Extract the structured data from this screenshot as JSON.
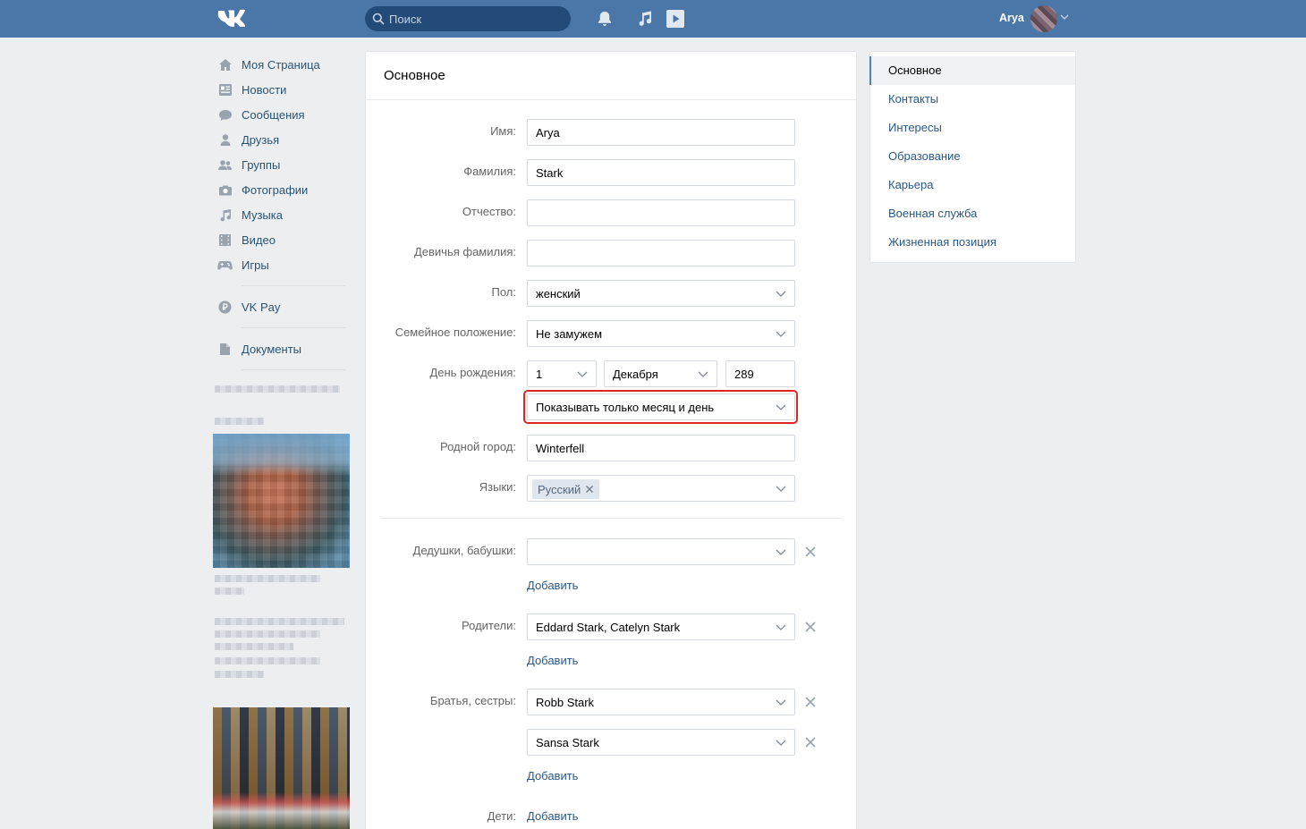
{
  "header": {
    "logo_text": "VK",
    "search_placeholder": "Поиск",
    "user_name": "Arya",
    "colors": {
      "bar": "#4a76a8",
      "search_bg": "#224b7a"
    }
  },
  "leftnav": {
    "items": [
      {
        "label": "Моя Страница",
        "icon": "home-icon"
      },
      {
        "label": "Новости",
        "icon": "news-icon"
      },
      {
        "label": "Сообщения",
        "icon": "messages-icon"
      },
      {
        "label": "Друзья",
        "icon": "friends-icon"
      },
      {
        "label": "Группы",
        "icon": "groups-icon"
      },
      {
        "label": "Фотографии",
        "icon": "camera-icon"
      },
      {
        "label": "Музыка",
        "icon": "music-icon"
      },
      {
        "label": "Видео",
        "icon": "video-icon"
      },
      {
        "label": "Игры",
        "icon": "gamepad-icon"
      }
    ],
    "pay": {
      "label": "VK Pay",
      "icon": "ruble-icon"
    },
    "docs": {
      "label": "Документы",
      "icon": "document-icon"
    }
  },
  "main": {
    "title": "Основное",
    "fields": {
      "first_name": {
        "label": "Имя:",
        "value": "Arya"
      },
      "last_name": {
        "label": "Фамилия:",
        "value": "Stark"
      },
      "patronymic": {
        "label": "Отчество:",
        "value": ""
      },
      "maiden_name": {
        "label": "Девичья фамилия:",
        "value": ""
      },
      "sex": {
        "label": "Пол:",
        "value": "женский"
      },
      "relationship": {
        "label": "Семейное положение:",
        "value": "Не замужем"
      },
      "birthday": {
        "label": "День рождения:",
        "day": "1",
        "month": "Декабря",
        "year": "289",
        "visibility": "Показывать только месяц и день"
      },
      "hometown": {
        "label": "Родной город:",
        "value": "Winterfell"
      },
      "languages": {
        "label": "Языки:",
        "tags": [
          "Русский"
        ]
      }
    },
    "relatives": {
      "grandparents": {
        "label": "Дедушки, бабушки:",
        "value": "",
        "add": "Добавить"
      },
      "parents": {
        "label": "Родители:",
        "value": "Eddard Stark, Catelyn Stark",
        "add": "Добавить"
      },
      "siblings": {
        "label": "Братья, сестры:",
        "values": [
          "Robb Stark",
          "Sansa Stark"
        ],
        "add": "Добавить"
      },
      "children": {
        "label": "Дети:",
        "add": "Добавить"
      }
    },
    "highlight_color": "#e02525"
  },
  "rightmenu": {
    "items": [
      {
        "label": "Основное",
        "active": true
      },
      {
        "label": "Контакты",
        "active": false
      },
      {
        "label": "Интересы",
        "active": false
      },
      {
        "label": "Образование",
        "active": false
      },
      {
        "label": "Карьера",
        "active": false
      },
      {
        "label": "Военная служба",
        "active": false
      },
      {
        "label": "Жизненная позиция",
        "active": false
      }
    ]
  }
}
